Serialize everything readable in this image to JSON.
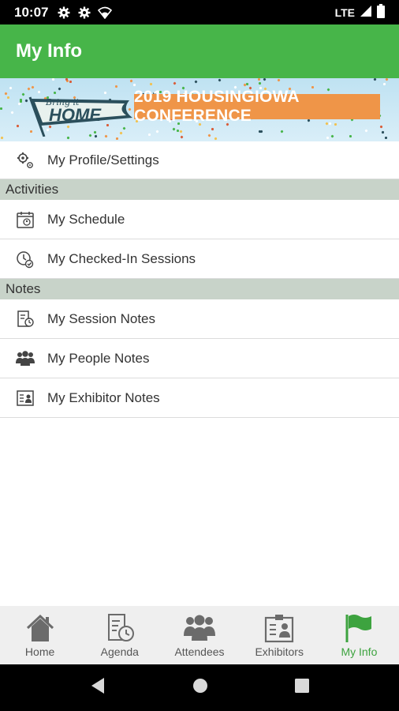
{
  "status_bar": {
    "time": "10:07",
    "network": "LTE",
    "icons": [
      "settings-gear-icon",
      "settings-gear-icon",
      "wifi-icon",
      "signal-icon",
      "battery-icon"
    ]
  },
  "app_bar": {
    "title": "My Info"
  },
  "banner": {
    "script_text": "Bring it",
    "home_text": "HOME",
    "title": "2019 HOUSINGIOWA CONFERENCE"
  },
  "list": {
    "profile": "My Profile/Settings",
    "activities_header": "Activities",
    "schedule": "My Schedule",
    "checked_in": "My Checked-In Sessions",
    "notes_header": "Notes",
    "session_notes": "My Session Notes",
    "people_notes": "My People Notes",
    "exhibitor_notes": "My Exhibitor Notes"
  },
  "tabs": [
    {
      "label": "Home",
      "icon": "home-icon"
    },
    {
      "label": "Agenda",
      "icon": "agenda-icon"
    },
    {
      "label": "Attendees",
      "icon": "attendees-icon"
    },
    {
      "label": "Exhibitors",
      "icon": "exhibitors-icon"
    },
    {
      "label": "My Info",
      "icon": "flag-icon"
    }
  ],
  "colors": {
    "primary": "#47b549",
    "section_bg": "#c8d3c9",
    "ribbon": "#ef9548",
    "tab_active": "#3da33f"
  }
}
